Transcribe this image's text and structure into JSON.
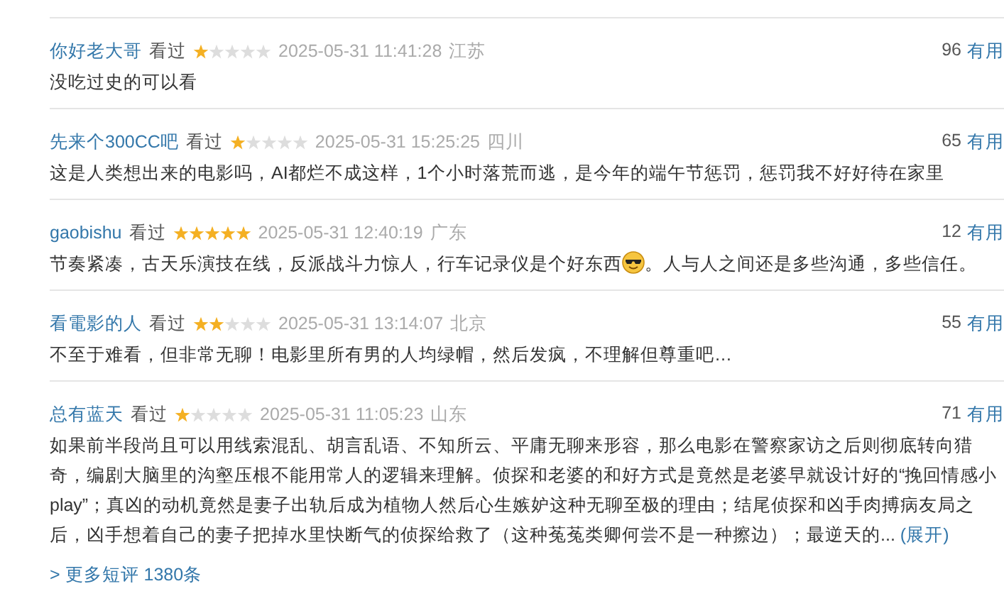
{
  "reviews": [
    {
      "user": "你好老大哥",
      "status": "看过",
      "stars": 1,
      "time": "2025-05-31 11:41:28",
      "region": "江苏",
      "votes": "96",
      "useful": "有用",
      "text": "没吃过史的可以看"
    },
    {
      "user": "先来个300CC吧",
      "status": "看过",
      "stars": 1,
      "time": "2025-05-31 15:25:25",
      "region": "四川",
      "votes": "65",
      "useful": "有用",
      "text": "这是人类想出来的电影吗，AI都烂不成这样，1个小时落荒而逃，是今年的端午节惩罚，惩罚我不好好待在家里"
    },
    {
      "user": "gaobishu",
      "status": "看过",
      "stars": 5,
      "time": "2025-05-31 12:40:19",
      "region": "广东",
      "votes": "12",
      "useful": "有用",
      "text": "节奏紧凑，古天乐演技在线，反派战斗力惊人，行车记录仪是个好东西",
      "text_after": "。人与人之间还是多些沟通，多些信任。"
    },
    {
      "user": "看電影的人",
      "status": "看过",
      "stars": 2,
      "time": "2025-05-31 13:14:07",
      "region": "北京",
      "votes": "55",
      "useful": "有用",
      "text": "不至于难看，但非常无聊！电影里所有男的人均绿帽，然后发疯，不理解但尊重吧…"
    },
    {
      "user": "总有蓝天",
      "status": "看过",
      "stars": 1,
      "time": "2025-05-31 11:05:23",
      "region": "山东",
      "votes": "71",
      "useful": "有用",
      "text": "如果前半段尚且可以用线索混乱、胡言乱语、不知所云、平庸无聊来形容，那么电影在警察家访之后则彻底转向猎奇，编剧大脑里的沟壑压根不能用常人的逻辑来理解。侦探和老婆的和好方式是竟然是老婆早就设计好的“挽回情感小play”；真凶的动机竟然是妻子出轨后成为植物人然后心生嫉妒这种无聊至极的理由；结尾侦探和凶手肉搏病友局之后，凶手想着自己的妻子把掉水里快断气的侦探给救了（这种菟菟类卿何尝不是一种擦边）；最逆天的...",
      "expand": "(展开)"
    }
  ],
  "more": "> 更多短评 1380条"
}
